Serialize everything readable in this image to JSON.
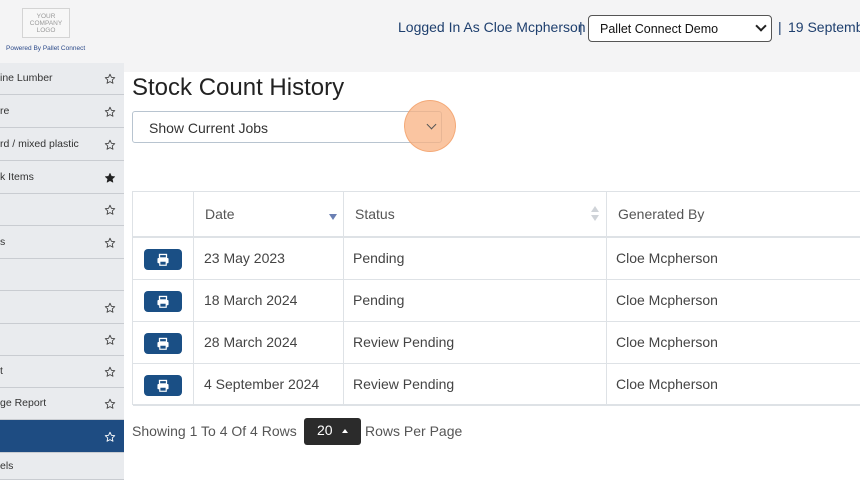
{
  "header": {
    "logo_text": "YOUR\nCOMPANY\nLOGO",
    "powered_by": "Powered By Pallet Connect",
    "logged_in": "Logged In As Cloe Mcpherson",
    "separator": "|",
    "site_select_value": "Pallet Connect Demo",
    "date_text": "19 Septemb"
  },
  "sidebar": {
    "items": [
      {
        "label": "ine Lumber",
        "star": "outline"
      },
      {
        "label": "re",
        "star": "outline"
      },
      {
        "label": "rd / mixed plastic",
        "star": "outline"
      },
      {
        "label": "k Items",
        "star": "filled"
      },
      {
        "label": "",
        "star": "outline"
      },
      {
        "label": "s",
        "star": "outline"
      },
      {
        "label": "",
        "star": "none"
      },
      {
        "label": "",
        "star": "outline"
      },
      {
        "label": "",
        "star": "outline"
      },
      {
        "label": "t",
        "star": "outline"
      },
      {
        "label": "ge Report",
        "star": "outline"
      },
      {
        "label": "",
        "star": "outline",
        "active": true
      },
      {
        "label": "els",
        "star": "none"
      }
    ]
  },
  "main": {
    "title": "Stock Count History",
    "jobs_select_value": "Show Current Jobs"
  },
  "table": {
    "headers": [
      "",
      "Date",
      "Status",
      "Generated By"
    ],
    "rows": [
      {
        "date": "23 May 2023",
        "status": "Pending",
        "generated_by": "Cloe Mcpherson"
      },
      {
        "date": "18 March 2024",
        "status": "Pending",
        "generated_by": "Cloe Mcpherson"
      },
      {
        "date": "28 March 2024",
        "status": "Review Pending",
        "generated_by": "Cloe Mcpherson"
      },
      {
        "date": "4 September 2024",
        "status": "Review Pending",
        "generated_by": "Cloe Mcpherson"
      }
    ]
  },
  "pagination": {
    "showing_text": "Showing 1 To 4 Of 4 Rows",
    "page_size": "20",
    "rows_per_page_label": "Rows Per Page"
  },
  "colors": {
    "accent": "#1e4c82",
    "header_text": "#1e3f6e",
    "click_highlight": "#f8b282"
  },
  "icons": {
    "print": "printer-icon",
    "star_outline": "star-outline-icon",
    "star_filled": "star-filled-icon",
    "sort_desc": "sort-desc-icon",
    "sort_both": "sort-both-icon",
    "chevron": "chevron-down-icon",
    "caret_up": "caret-up-icon"
  }
}
